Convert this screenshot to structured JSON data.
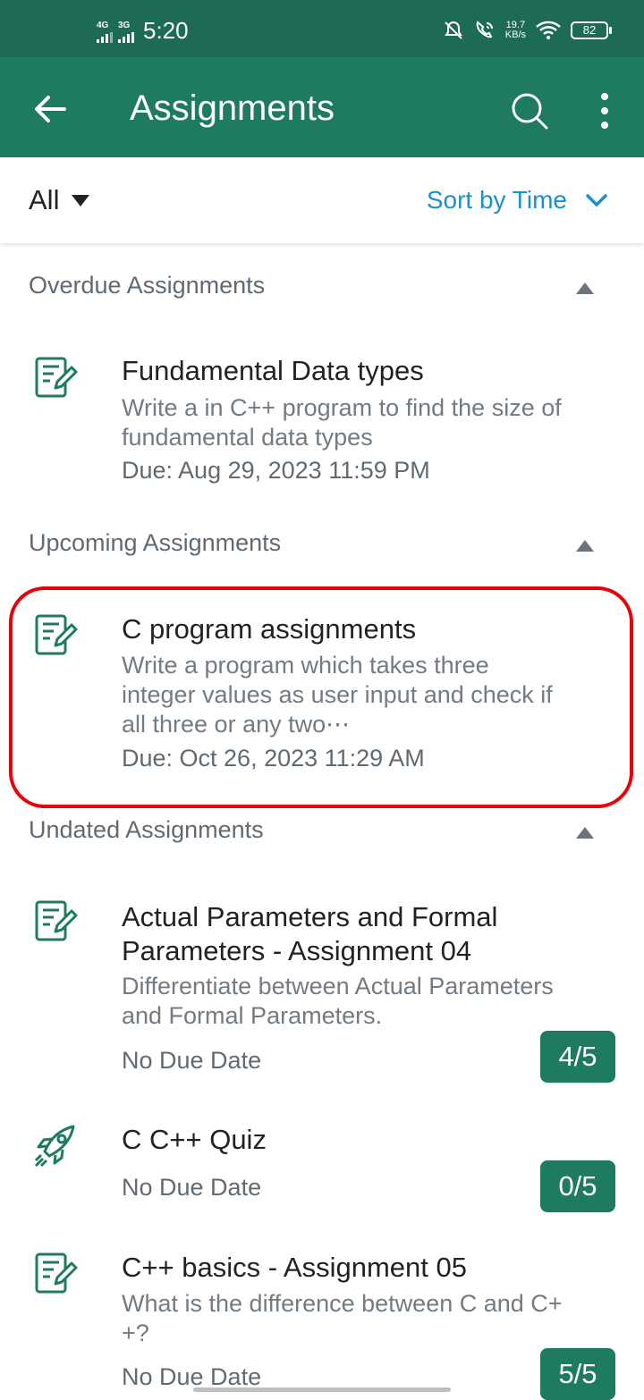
{
  "status_bar": {
    "net1": "4G",
    "net2": "3G",
    "time": "5:20",
    "speed_value": "19.7",
    "speed_unit": "KB/s",
    "battery": "82"
  },
  "app_bar": {
    "title": "Assignments"
  },
  "filter": {
    "selected": "All",
    "sort_label": "Sort by Time"
  },
  "sections": {
    "overdue": {
      "title": "Overdue Assignments",
      "items": [
        {
          "icon": "assignment-icon",
          "title": "Fundamental Data types",
          "desc_line1": "Write a in C++ program to find the size of",
          "desc_line2": "fundamental data types",
          "due": "Due: Aug 29, 2023 11:59 PM"
        }
      ]
    },
    "upcoming": {
      "title": "Upcoming Assignments",
      "items": [
        {
          "icon": "assignment-icon",
          "title": "C program assignments",
          "desc_line1": "Write a program which takes three",
          "desc_line2": "integer values as user input and check if",
          "desc_line3": "all three or any two⋯",
          "due": "Due: Oct 26, 2023 11:29 AM"
        }
      ]
    },
    "undated": {
      "title": "Undated Assignments",
      "items": [
        {
          "icon": "assignment-icon",
          "title_line1": "Actual Parameters and Formal",
          "title_line2": "Parameters - Assignment 04",
          "desc_line1": "Differentiate between Actual Parameters",
          "desc_line2": "and Formal Parameters.",
          "due": "No Due Date",
          "score": "4/5"
        },
        {
          "icon": "rocket-icon",
          "title": "C C++ Quiz",
          "due": "No Due Date",
          "score": "0/5"
        },
        {
          "icon": "assignment-icon",
          "title": "C++ basics - Assignment 05",
          "desc_line1": "What is the difference between C and C+",
          "desc_line2": "+?",
          "due": "No Due Date",
          "score": "5/5"
        }
      ]
    }
  },
  "colors": {
    "status_bar": "#1d6b55",
    "app_bar": "#1e7a60",
    "sort_link": "#1a8fd1",
    "score_badge": "#1e7a60",
    "highlight": "#e8000b"
  }
}
